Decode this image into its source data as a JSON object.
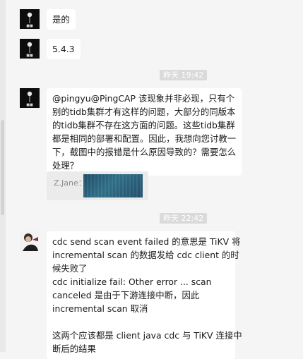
{
  "messages": [
    {
      "text_lines": [
        "是的"
      ]
    },
    {
      "text_lines": [
        "5.4.3"
      ]
    },
    {
      "text_lines": [
        "@pingyu@PingCAP 该现象并非必现，只有个",
        "别的tidb集群才有这样的问题，大部分的同版本",
        "的tidb集群不存在这方面的问题。这些tidb集群",
        "都是相同的部署和配置。因此，我想向您讨教一",
        "下，截图中的报错是什么原因导致的？需要怎么",
        "处理？"
      ],
      "quote": {
        "name": "Z.Jane："
      }
    },
    {
      "text_lines": [
        "cdc send scan event failed 的意思是 TiKV 将",
        "incremental scan 的数据发给 cdc client 的时",
        "候失败了",
        "cdc initialize fail: Other error ... scan",
        "canceled 是由于下游连接中断，因此",
        "incremental scan 取消",
        "",
        "这两个应该都是 client java cdc 与 TiKV 连接中",
        "断后的结果"
      ]
    }
  ],
  "timestamps": [
    "昨天 19:42",
    "昨天 22:42"
  ],
  "colors": {
    "background": "#f5f5f5",
    "bubble": "#ffffff",
    "timestamp_bg": "#dadada"
  }
}
